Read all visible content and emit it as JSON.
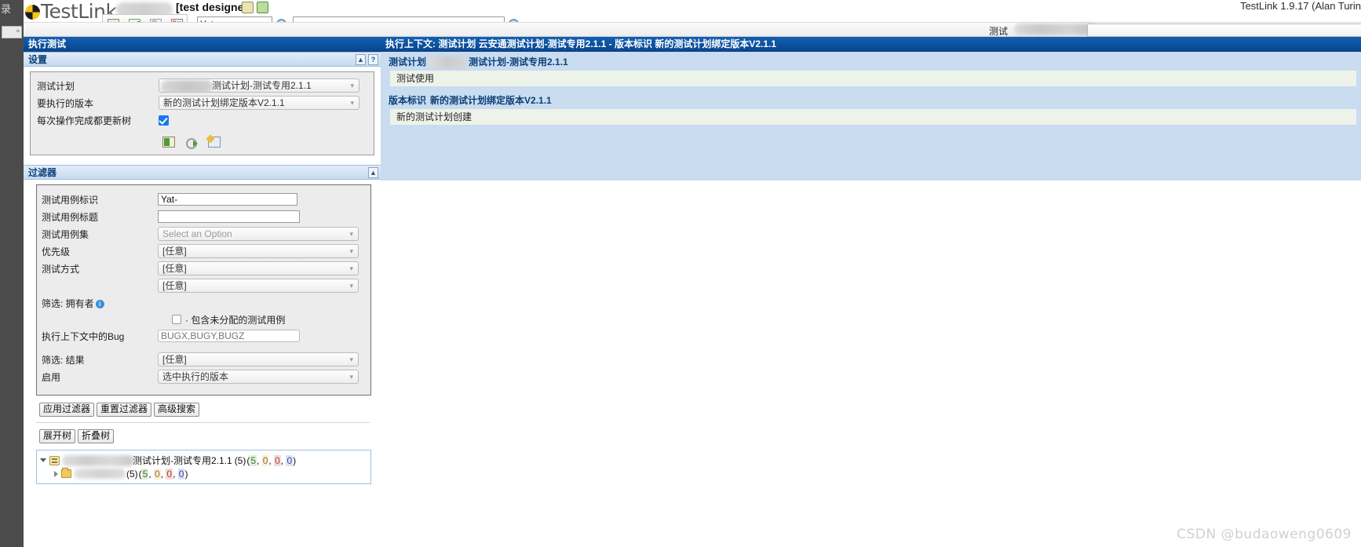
{
  "app": {
    "brand": "TestLink",
    "role": "[test designer]",
    "version_text": "TestLink 1.9.17 (Alan Turin"
  },
  "toolbar": {
    "icons": [
      "requirements-icon",
      "metrics-icon",
      "navigate-icon",
      "docs-icon"
    ],
    "header_icons": [
      "pencil-icon",
      "screens-icon"
    ],
    "mini_search_value": "Yat-",
    "mini_search_placeholder": "",
    "main_search_value": "",
    "main_search_placeholder": ""
  },
  "project_selector": {
    "label": "测试",
    "selected": ""
  },
  "left": {
    "title": "执行测试",
    "settings": {
      "title": "设置",
      "collapse_label": "▲",
      "help_label": "?",
      "rows": [
        {
          "label": "测试计划",
          "value": "测试计划-测试专用2.1.1",
          "blurred": true
        },
        {
          "label": "要执行的版本",
          "value": "新的测试计划绑定版本V2.1.1",
          "blurred": false
        }
      ],
      "checkbox_label": "每次操作完成都更新树",
      "checkbox_checked": true,
      "action_icons": [
        "export-icon",
        "refresh-icon",
        "print-icon"
      ]
    },
    "filter": {
      "title": "过滤器",
      "collapse_label": "▲",
      "rows": [
        {
          "label": "测试用例标识",
          "type": "text",
          "value": "Yat-",
          "placeholder": ""
        },
        {
          "label": "测试用例标题",
          "type": "text",
          "value": "",
          "placeholder": ""
        },
        {
          "label": "测试用例集",
          "type": "select",
          "value": "Select an Option",
          "placeholder_style": true
        },
        {
          "label": "优先级",
          "type": "select",
          "value": "[任意]",
          "placeholder_style": false
        },
        {
          "label": "测试方式",
          "type": "select",
          "value": "[任意]",
          "placeholder_style": false
        },
        {
          "label": "",
          "type": "select",
          "value": "[任意]",
          "placeholder_style": false
        },
        {
          "label": "筛选: 拥有者",
          "type": "owner",
          "value": "",
          "info": "i"
        },
        {
          "label": "",
          "type": "checkbox",
          "value": "· 包含未分配的测试用例",
          "checked": false
        },
        {
          "label": "执行上下文中的Bug",
          "type": "text",
          "value": "",
          "placeholder": "BUGX,BUGY,BUGZ"
        },
        {
          "label": "筛选: 结果",
          "type": "select",
          "value": "[任意]",
          "placeholder_style": false
        },
        {
          "label": "启用",
          "type": "select",
          "value": "选中执行的版本",
          "placeholder_style": false
        }
      ],
      "buttons": [
        "应用过滤器",
        "重置过滤器",
        "高级搜索"
      ]
    },
    "tree": {
      "buttons": [
        "展开树",
        "折叠树"
      ],
      "nodes": [
        {
          "icon": "testplan-icon",
          "blurred_prefix": true,
          "label": "测试计划-测试专用2.1.1",
          "total": "(5)",
          "counts": [
            "5",
            "0",
            "0",
            "0"
          ],
          "expanded": true,
          "level": 0
        },
        {
          "icon": "folder-icon",
          "blurred_prefix": true,
          "label": "",
          "total": "(5)",
          "counts": [
            "5",
            "0",
            "0",
            "0"
          ],
          "expanded": false,
          "level": 1
        }
      ]
    }
  },
  "right": {
    "context_bar": "执行上下文: 测试计划 云安通测试计划-测试专用2.1.1 - 版本标识 新的测试计划绑定版本V2.1.1",
    "blocks": [
      {
        "heading_prefix": "测试计划",
        "heading_blurred": true,
        "heading_suffix": "测试计划-测试专用2.1.1",
        "body": "测试使用"
      },
      {
        "heading_prefix": "版本标识",
        "heading_blurred": false,
        "heading_suffix": "新的测试计划绑定版本V2.1.1",
        "body": "新的测试计划创建"
      }
    ]
  },
  "watermark": "CSDN @budaoweng0609",
  "colors": {
    "title_bar": "#0a4489",
    "section_bar": "#c6dbf0",
    "context_body": "#c9dcf0",
    "accent_link": "#0b3f77",
    "checkbox": "#1878f0"
  }
}
